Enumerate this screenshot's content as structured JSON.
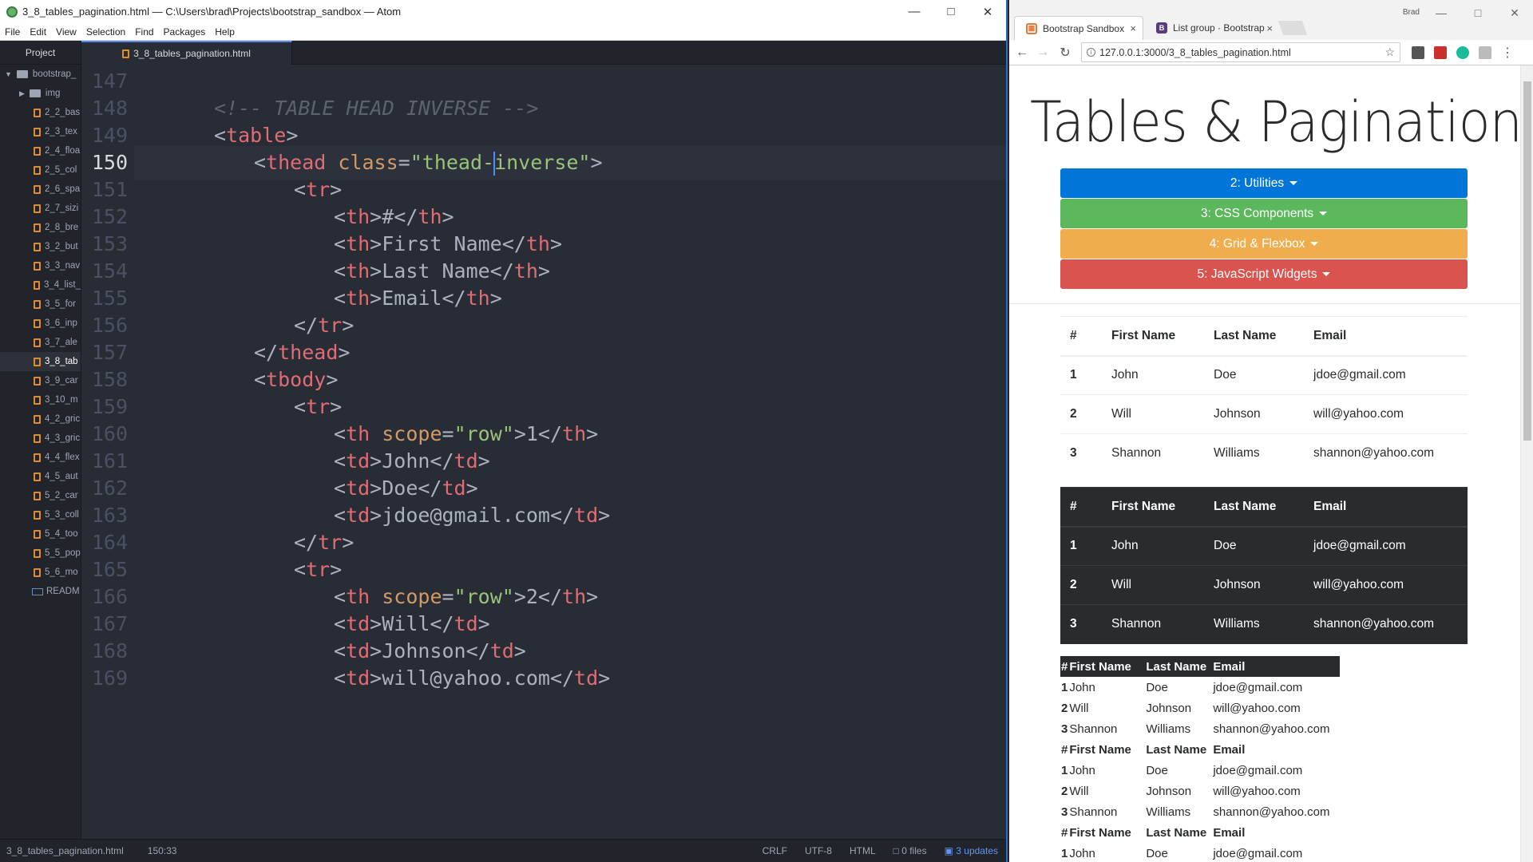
{
  "atom": {
    "title": "3_8_tables_pagination.html — C:\\Users\\brad\\Projects\\bootstrap_sandbox — Atom",
    "menu": [
      "File",
      "Edit",
      "View",
      "Selection",
      "Find",
      "Packages",
      "Help"
    ],
    "project_tab": "Project",
    "file_tab": "3_8_tables_pagination.html",
    "tree": {
      "root": "bootstrap_",
      "folder": "img",
      "files": [
        "2_2_bas",
        "2_3_tex",
        "2_4_floa",
        "2_5_col",
        "2_6_spa",
        "2_7_sizi",
        "2_8_bre",
        "3_2_but",
        "3_3_nav",
        "3_4_list_",
        "3_5_for",
        "3_6_inp",
        "3_7_ale",
        "3_8_tab",
        "3_9_car",
        "3_10_m",
        "4_2_gric",
        "4_3_gric",
        "4_4_flex",
        "4_5_aut",
        "5_2_car",
        "5_3_coll",
        "5_4_too",
        "5_5_pop",
        "5_6_mo"
      ],
      "readme": "READM",
      "active_file": "3_8_tab"
    },
    "line_numbers": [
      "147",
      "148",
      "149",
      "150",
      "151",
      "152",
      "153",
      "154",
      "155",
      "156",
      "157",
      "158",
      "159",
      "160",
      "161",
      "162",
      "163",
      "164",
      "165",
      "166",
      "167",
      "168",
      "169"
    ],
    "current_line": "150",
    "status": {
      "file": "3_8_tables_pagination.html",
      "position": "150:33",
      "line_ending": "CRLF",
      "encoding": "UTF-8",
      "grammar": "HTML",
      "files": "0 files",
      "updates": "3 updates"
    }
  },
  "chrome": {
    "user": "Brad",
    "tabs": [
      {
        "title": "Bootstrap Sandbox",
        "close": "×"
      },
      {
        "title": "List group · Bootstrap",
        "close": "×"
      }
    ],
    "url": "127.0.0.1:3000/3_8_tables_pagination.html",
    "page": {
      "title": "Tables & Pagination",
      "dropdowns": [
        {
          "label": "2: Utilities",
          "color": "#0275d8"
        },
        {
          "label": "3: CSS Components",
          "color": "#5cb85c"
        },
        {
          "label": "4: Grid & Flexbox",
          "color": "#f0ad4e"
        },
        {
          "label": "5: JavaScript Widgets",
          "color": "#d9534f"
        }
      ],
      "table_headers": [
        "#",
        "First Name",
        "Last Name",
        "Email"
      ],
      "rows": [
        [
          "1",
          "John",
          "Doe",
          "jdoe@gmail.com"
        ],
        [
          "2",
          "Will",
          "Johnson",
          "will@yahoo.com"
        ],
        [
          "3",
          "Shannon",
          "Williams",
          "shannon@yahoo.com"
        ]
      ]
    }
  },
  "colors": {
    "dropdown_blue": "#0275d8",
    "dropdown_green": "#5cb85c",
    "dropdown_yellow": "#f0ad4e",
    "dropdown_red": "#d9534f"
  }
}
